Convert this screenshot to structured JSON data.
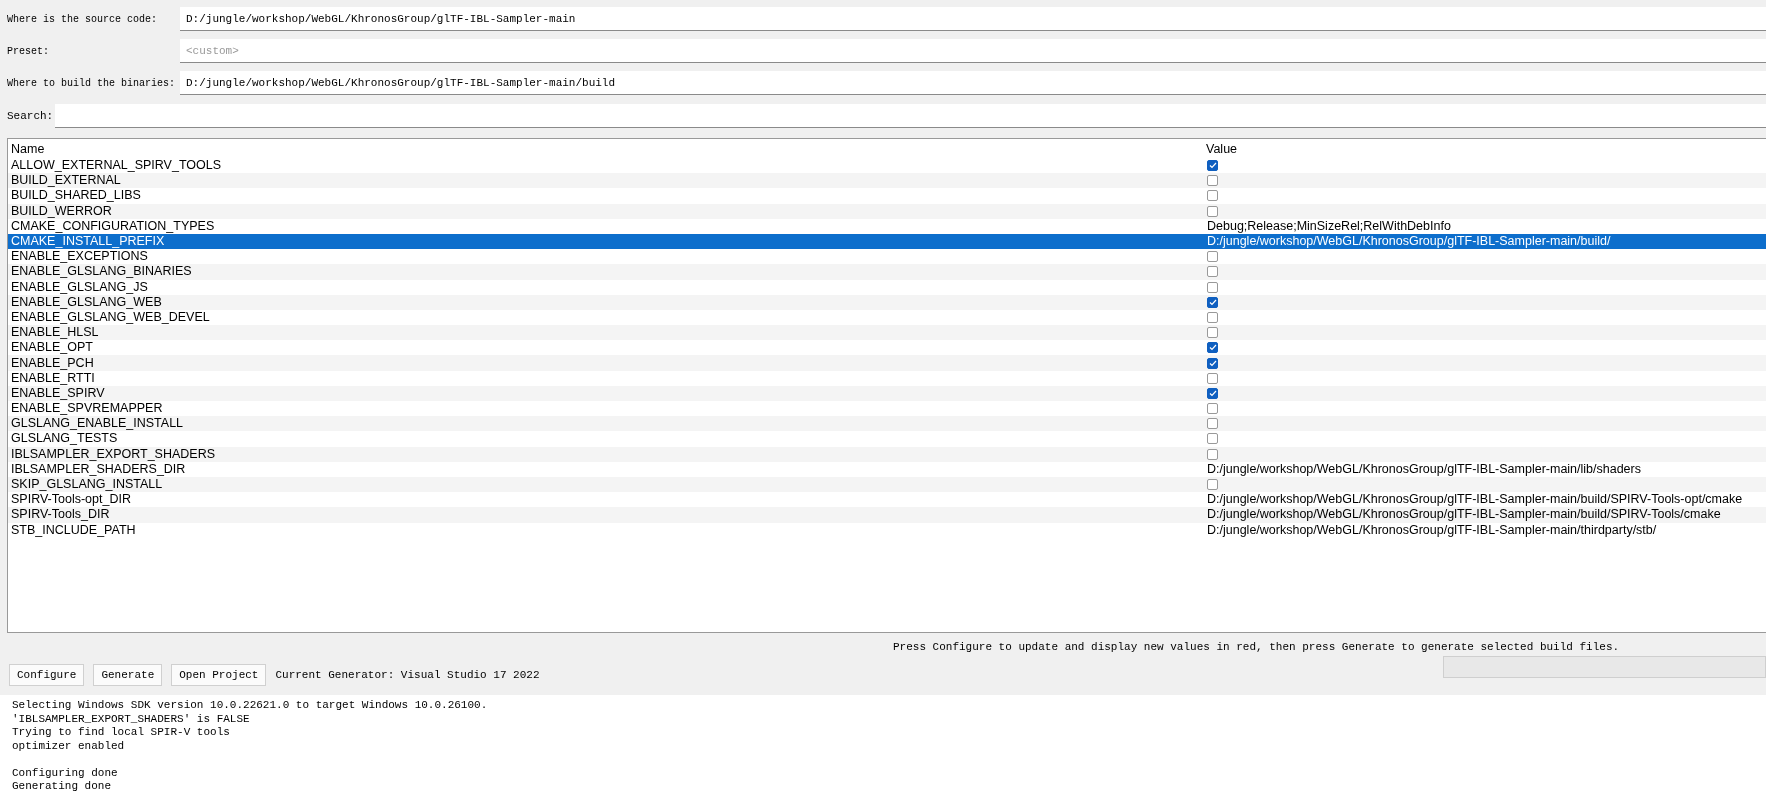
{
  "paths": [
    {
      "label": "Where is the source code:",
      "value": "D:/jungle/workshop/WebGL/KhronosGroup/glTF-IBL-Sampler-main"
    },
    {
      "label": "Preset:",
      "placeholder": "<custom>"
    },
    {
      "label": "Where to build the binaries:",
      "value": "D:/jungle/workshop/WebGL/KhronosGroup/glTF-IBL-Sampler-main/build"
    }
  ],
  "search": {
    "label": "Search:"
  },
  "table": {
    "columns": [
      "Name",
      "Value"
    ],
    "rows": [
      {
        "name": "ALLOW_EXTERNAL_SPIRV_TOOLS",
        "kind": "bool",
        "checked": true,
        "selected": false
      },
      {
        "name": "BUILD_EXTERNAL",
        "kind": "bool",
        "checked": false,
        "selected": false
      },
      {
        "name": "BUILD_SHARED_LIBS",
        "kind": "bool",
        "checked": false,
        "selected": false
      },
      {
        "name": "BUILD_WERROR",
        "kind": "bool",
        "checked": false,
        "selected": false
      },
      {
        "name": "CMAKE_CONFIGURATION_TYPES",
        "kind": "text",
        "value": "Debug;Release;MinSizeRel;RelWithDebInfo",
        "selected": false
      },
      {
        "name": "CMAKE_INSTALL_PREFIX",
        "kind": "text",
        "value": "D:/jungle/workshop/WebGL/KhronosGroup/glTF-IBL-Sampler-main/build/",
        "selected": true
      },
      {
        "name": "ENABLE_EXCEPTIONS",
        "kind": "bool",
        "checked": false,
        "selected": false
      },
      {
        "name": "ENABLE_GLSLANG_BINARIES",
        "kind": "bool",
        "checked": false,
        "selected": false
      },
      {
        "name": "ENABLE_GLSLANG_JS",
        "kind": "bool",
        "checked": false,
        "selected": false
      },
      {
        "name": "ENABLE_GLSLANG_WEB",
        "kind": "bool",
        "checked": true,
        "selected": false
      },
      {
        "name": "ENABLE_GLSLANG_WEB_DEVEL",
        "kind": "bool",
        "checked": false,
        "selected": false
      },
      {
        "name": "ENABLE_HLSL",
        "kind": "bool",
        "checked": false,
        "selected": false
      },
      {
        "name": "ENABLE_OPT",
        "kind": "bool",
        "checked": true,
        "selected": false
      },
      {
        "name": "ENABLE_PCH",
        "kind": "bool",
        "checked": true,
        "selected": false
      },
      {
        "name": "ENABLE_RTTI",
        "kind": "bool",
        "checked": false,
        "selected": false
      },
      {
        "name": "ENABLE_SPIRV",
        "kind": "bool",
        "checked": true,
        "selected": false
      },
      {
        "name": "ENABLE_SPVREMAPPER",
        "kind": "bool",
        "checked": false,
        "selected": false
      },
      {
        "name": "GLSLANG_ENABLE_INSTALL",
        "kind": "bool",
        "checked": false,
        "selected": false
      },
      {
        "name": "GLSLANG_TESTS",
        "kind": "bool",
        "checked": false,
        "selected": false
      },
      {
        "name": "IBLSAMPLER_EXPORT_SHADERS",
        "kind": "bool",
        "checked": false,
        "selected": false
      },
      {
        "name": "IBLSAMPLER_SHADERS_DIR",
        "kind": "text",
        "value": "D:/jungle/workshop/WebGL/KhronosGroup/glTF-IBL-Sampler-main/lib/shaders",
        "selected": false
      },
      {
        "name": "SKIP_GLSLANG_INSTALL",
        "kind": "bool",
        "checked": false,
        "selected": false
      },
      {
        "name": "SPIRV-Tools-opt_DIR",
        "kind": "text",
        "value": "D:/jungle/workshop/WebGL/KhronosGroup/glTF-IBL-Sampler-main/build/SPIRV-Tools-opt/cmake",
        "selected": false
      },
      {
        "name": "SPIRV-Tools_DIR",
        "kind": "text",
        "value": "D:/jungle/workshop/WebGL/KhronosGroup/glTF-IBL-Sampler-main/build/SPIRV-Tools/cmake",
        "selected": false
      },
      {
        "name": "STB_INCLUDE_PATH",
        "kind": "text",
        "value": "D:/jungle/workshop/WebGL/KhronosGroup/glTF-IBL-Sampler-main/thirdparty/stb/",
        "selected": false
      }
    ]
  },
  "hint": "Press Configure to update and display new values in red, then press Generate to generate selected build files.",
  "buttons": [
    "Configure",
    "Generate",
    "Open Project"
  ],
  "generator": "Current Generator: Visual Studio 17 2022",
  "progress": {
    "level": 0
  },
  "log": [
    [
      "Selecting Windows SDK version 10.0.22621.0 to target Windows 10.0.26100.",
      "'IBLSAMPLER_EXPORT_SHADERS' is FALSE",
      "Trying to find local SPIR-V tools",
      "optimizer enabled"
    ],
    [
      "Configuring done",
      "Generating done"
    ]
  ]
}
